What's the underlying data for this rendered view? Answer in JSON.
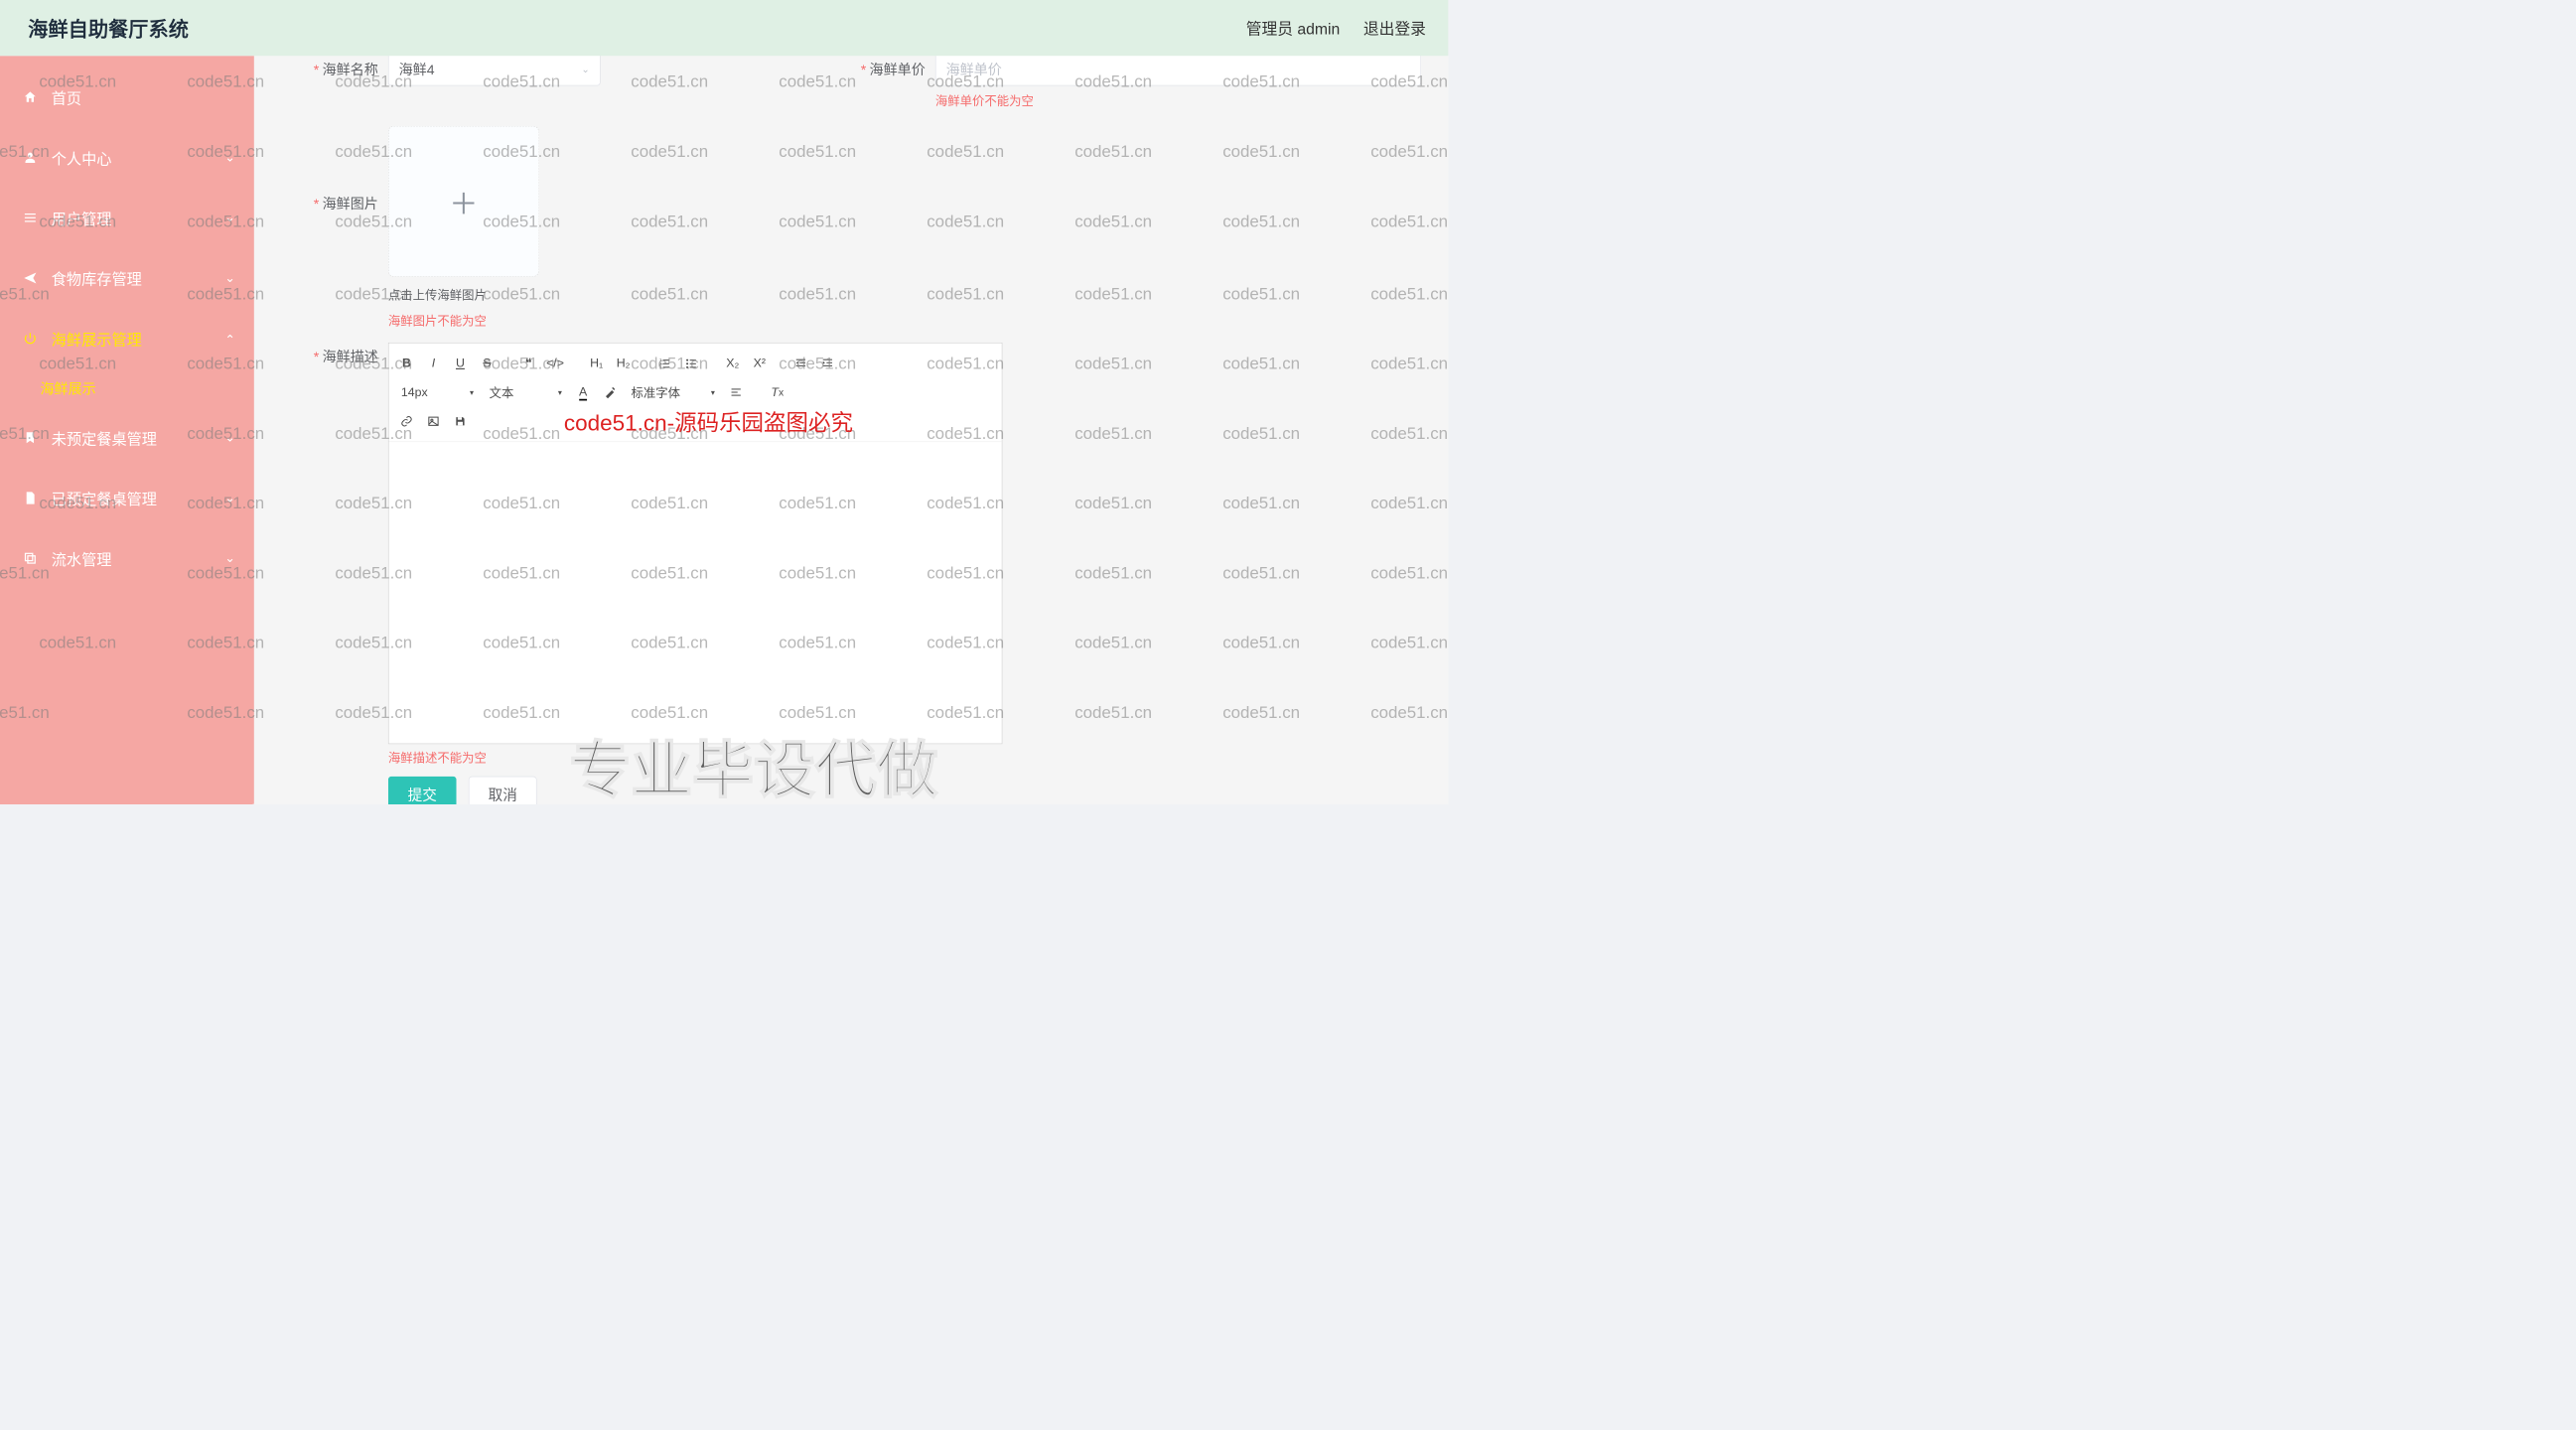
{
  "header": {
    "title": "海鲜自助餐厅系统",
    "user_label": "管理员 admin",
    "logout_label": "退出登录"
  },
  "sidebar": {
    "items": [
      {
        "label": "首页",
        "icon": "home-icon",
        "expandable": false
      },
      {
        "label": "个人中心",
        "icon": "user-icon",
        "expandable": true
      },
      {
        "label": "用户管理",
        "icon": "menu-icon",
        "expandable": true
      },
      {
        "label": "食物库存管理",
        "icon": "send-icon",
        "expandable": true
      },
      {
        "label": "海鲜展示管理",
        "icon": "power-icon",
        "expandable": true,
        "active": true
      },
      {
        "label": "未预定餐桌管理",
        "icon": "bookmark-icon",
        "expandable": true
      },
      {
        "label": "已预定餐桌管理",
        "icon": "doc-icon",
        "expandable": true
      },
      {
        "label": "流水管理",
        "icon": "copy-icon",
        "expandable": true
      }
    ],
    "sub_active": "海鲜展示"
  },
  "form": {
    "name_label": "海鲜名称",
    "name_value": "海鲜4",
    "price_label": "海鲜单价",
    "price_placeholder": "海鲜单价",
    "price_error": "海鲜单价不能为空",
    "image_label": "海鲜图片",
    "image_hint": "点击上传海鲜图片",
    "image_error": "海鲜图片不能为空",
    "desc_label": "海鲜描述",
    "desc_error": "海鲜描述不能为空",
    "submit_label": "提交",
    "cancel_label": "取消"
  },
  "editor": {
    "font_size": "14px",
    "style_label": "文本",
    "font_family": "标准字体"
  },
  "overlays": {
    "watermark_text": "code51.cn",
    "center_text": "code51.cn-源码乐园盗图必究",
    "bottom_text": "专业毕设代做"
  }
}
